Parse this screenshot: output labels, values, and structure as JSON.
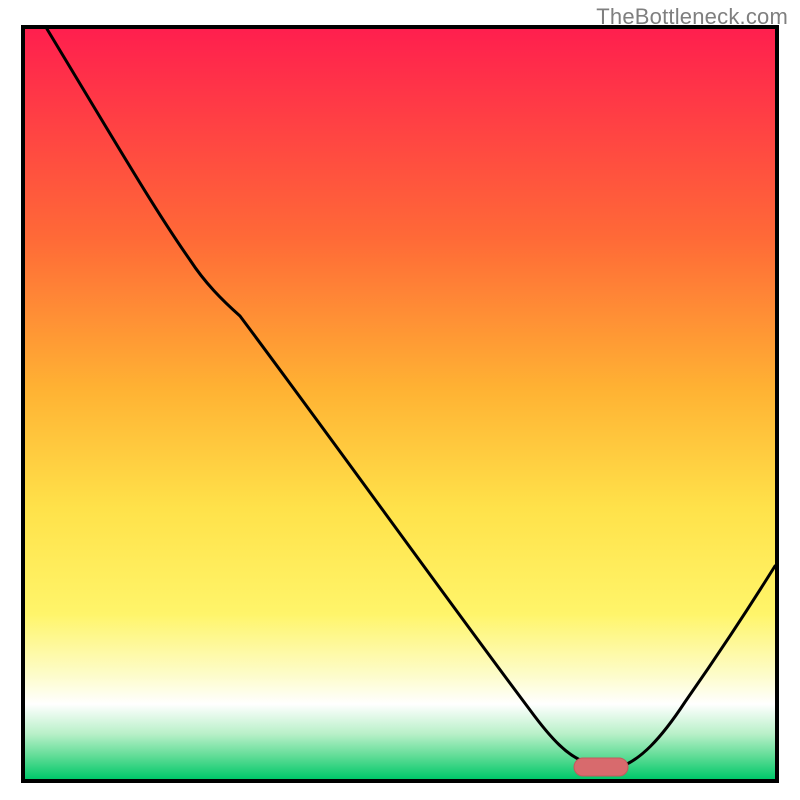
{
  "watermark": "TheBottleneck.com",
  "chart_data": {
    "type": "line",
    "title": "",
    "xlabel": "",
    "ylabel": "",
    "x": [
      0.06,
      0.16,
      0.22,
      0.26,
      0.38,
      0.5,
      0.62,
      0.7,
      0.74,
      0.78,
      0.84,
      0.9,
      1.0
    ],
    "values": [
      1.0,
      0.8,
      0.7,
      0.66,
      0.5,
      0.34,
      0.18,
      0.06,
      0.02,
      0.02,
      0.05,
      0.12,
      0.28
    ],
    "xlim": [
      0,
      1
    ],
    "ylim": [
      0,
      1
    ],
    "palette": {
      "gradient": [
        "#ff1f4e",
        "#ff8b2a",
        "#ffd93a",
        "#fff56a",
        "#ffffff",
        "#8fe9b4",
        "#00c86a"
      ],
      "line": "#000000",
      "marker_fill": "#d86a6d",
      "marker_stroke": "#c25a5d"
    },
    "marker": {
      "x": 0.76,
      "y": 0.024
    }
  }
}
